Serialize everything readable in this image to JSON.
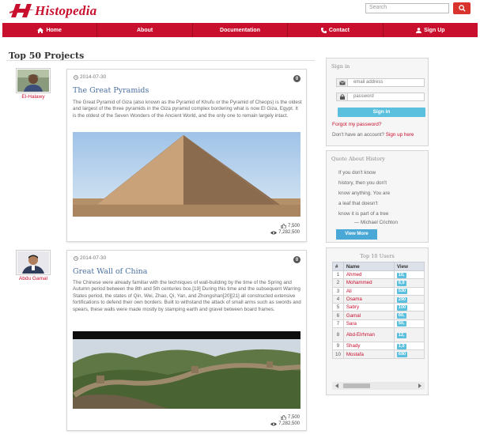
{
  "header": {
    "logo_text": "Histopedia",
    "search_placeholder": "Search"
  },
  "nav": {
    "items": [
      {
        "label": "Home",
        "icon": "home-icon"
      },
      {
        "label": "About",
        "icon": ""
      },
      {
        "label": "Documentation",
        "icon": ""
      },
      {
        "label": "Contact",
        "icon": "phone-icon"
      },
      {
        "label": "Sign Up",
        "icon": "user-icon"
      }
    ]
  },
  "page_title": "Top 50 Projects",
  "posts": [
    {
      "author": "El-Halawy",
      "date": "2014-07-30",
      "badge": "0",
      "title": "The Great Pyramids",
      "body": "The Great Pyramid of Giza (also known as the Pyramid of Khufu or the Pyramid of Cheops) is the oldest and largest of the three pyramids in the Giza pyramid complex bordering what is now El Giza, Egypt. It is the oldest of the Seven Wonders of the Ancient World, and the only one to remain largely intact.",
      "likes": "7,500",
      "views": "7,282,500"
    },
    {
      "author": "Abdu Gamal",
      "date": "2014-07-30",
      "badge": "0",
      "title": "Great Wall of China",
      "body": "The Chinese were already familiar with the techniques of wall-building by the time of the Spring and Autumn period between the 8th and 5th centuries bce.[19] During this time and the subsequent Warring States period, the states of Qin, Wei, Zhao, Qi, Yan, and Zhongshan[20][21] all constructed extensive fortifications to defend their own borders. Built to withstand the attack of small arms such as swords and spears, these walls were made mostly by stamping earth and gravel between board frames.",
      "likes": "7,500",
      "views": "7,282,500"
    }
  ],
  "signin": {
    "title": "Sign in",
    "email_placeholder": "email address",
    "password_placeholder": "password",
    "button": "Sign in",
    "forgot": "Forgot my password?",
    "no_account": "Don't have an account?",
    "signup_link": "Sign up here"
  },
  "quote_panel": {
    "title": "Quote About History",
    "lines": [
      "If you don't know",
      "history, then you don't",
      "know anything. You are",
      "a leaf that doesn't",
      "know it is part of a tree",
      "— Michael Crichton"
    ],
    "button": "View More"
  },
  "top_users": {
    "title": "Top 10 Users",
    "headers": [
      "#",
      "Name",
      "View"
    ],
    "rows": [
      {
        "rank": "1",
        "name": "Ahmed",
        "views": "10,"
      },
      {
        "rank": "2",
        "name": "Mohammed",
        "views": "6,9"
      },
      {
        "rank": "3",
        "name": "Ali",
        "views": "530"
      },
      {
        "rank": "4",
        "name": "Osama",
        "views": "290"
      },
      {
        "rank": "5",
        "name": "Sabry",
        "views": "100"
      },
      {
        "rank": "6",
        "name": "Gamal",
        "views": "60,"
      },
      {
        "rank": "7",
        "name": "Sara",
        "views": "50,"
      },
      {
        "rank": "8",
        "name": "Abd-Elrhman",
        "views": "12,"
      },
      {
        "rank": "9",
        "name": "Shady",
        "views": "1,0"
      },
      {
        "rank": "10",
        "name": "Mostafa",
        "views": "690"
      }
    ]
  },
  "colors": {
    "brand_red": "#c8102e",
    "info_blue": "#5bc0de",
    "title_blue": "#4a6fa0"
  }
}
